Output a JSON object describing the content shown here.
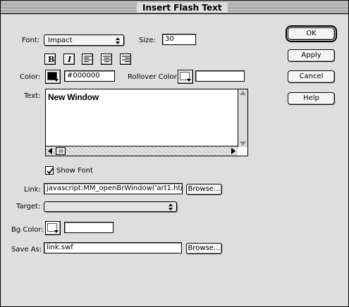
{
  "window": {
    "title": "Insert Flash Text"
  },
  "font": {
    "label": "Font:",
    "value": "Impact"
  },
  "size": {
    "label": "Size:",
    "value": "30"
  },
  "format_buttons": {
    "bold": "B",
    "italic": "I"
  },
  "color": {
    "label": "Color:",
    "value": "#000000",
    "swatch": "#000000"
  },
  "rollover_color": {
    "label": "Rollover Color:",
    "value": "",
    "swatch": "#ffffff"
  },
  "text": {
    "label": "Text:",
    "value": "New Window"
  },
  "show_font": {
    "label": "Show Font",
    "checked": true
  },
  "link": {
    "label": "Link:",
    "value": "javascript:MM_openBrWindow('art1.html',",
    "browse": "Browse..."
  },
  "target": {
    "label": "Target:",
    "value": ""
  },
  "bg_color": {
    "label": "Bg Color:",
    "value": "",
    "swatch": "#ffffff"
  },
  "save_as": {
    "label": "Save As:",
    "value": "link.swf",
    "browse": "Browse..."
  },
  "buttons": {
    "ok": "OK",
    "apply": "Apply",
    "cancel": "Cancel",
    "help": "Help"
  }
}
